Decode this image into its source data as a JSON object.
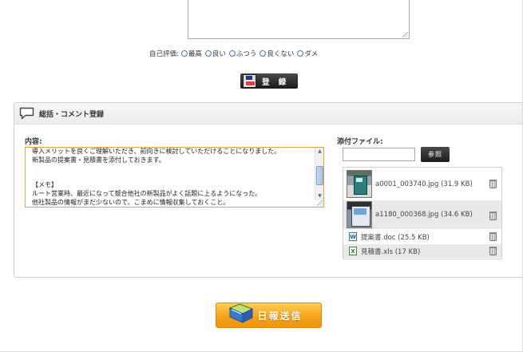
{
  "evaluation": {
    "label": "自己評価:",
    "options": [
      "最高",
      "良い",
      "ふつう",
      "良くない",
      "ダメ"
    ]
  },
  "register_button": {
    "label": "登 録"
  },
  "comment_section": {
    "title": "総括・コメント登録",
    "content_label": "内容:",
    "content_text": "導入メリットを良くご理解いただき、前向きに検討していただけることになりました。\n新製品の提案書・見積書を添付しておきます。\n\n\n【メモ】\nルート営業時、最近になって競合他社の新製品がよく話題に上るようになった。\n他社製品の情報がまだ少ないので、こまめに情報収集しておくこと。"
  },
  "attachments": {
    "label": "添付ファイル:",
    "browse_label": "参照",
    "files": [
      {
        "name": "a0001_003740.jpg (31.9 KB)",
        "type": "image"
      },
      {
        "name": "a1180_000368.jpg (34.6 KB)",
        "type": "image"
      },
      {
        "name": "提案書.doc (25.5 KB)",
        "type": "doc"
      },
      {
        "name": "見積書.xls (17 KB)",
        "type": "xls"
      }
    ]
  },
  "submit_button": {
    "label": "日報送信"
  },
  "colors": {
    "accent_orange": "#f6a21a",
    "textarea_focus": "#e8a33c",
    "dark_button": "#2a2a2a"
  }
}
